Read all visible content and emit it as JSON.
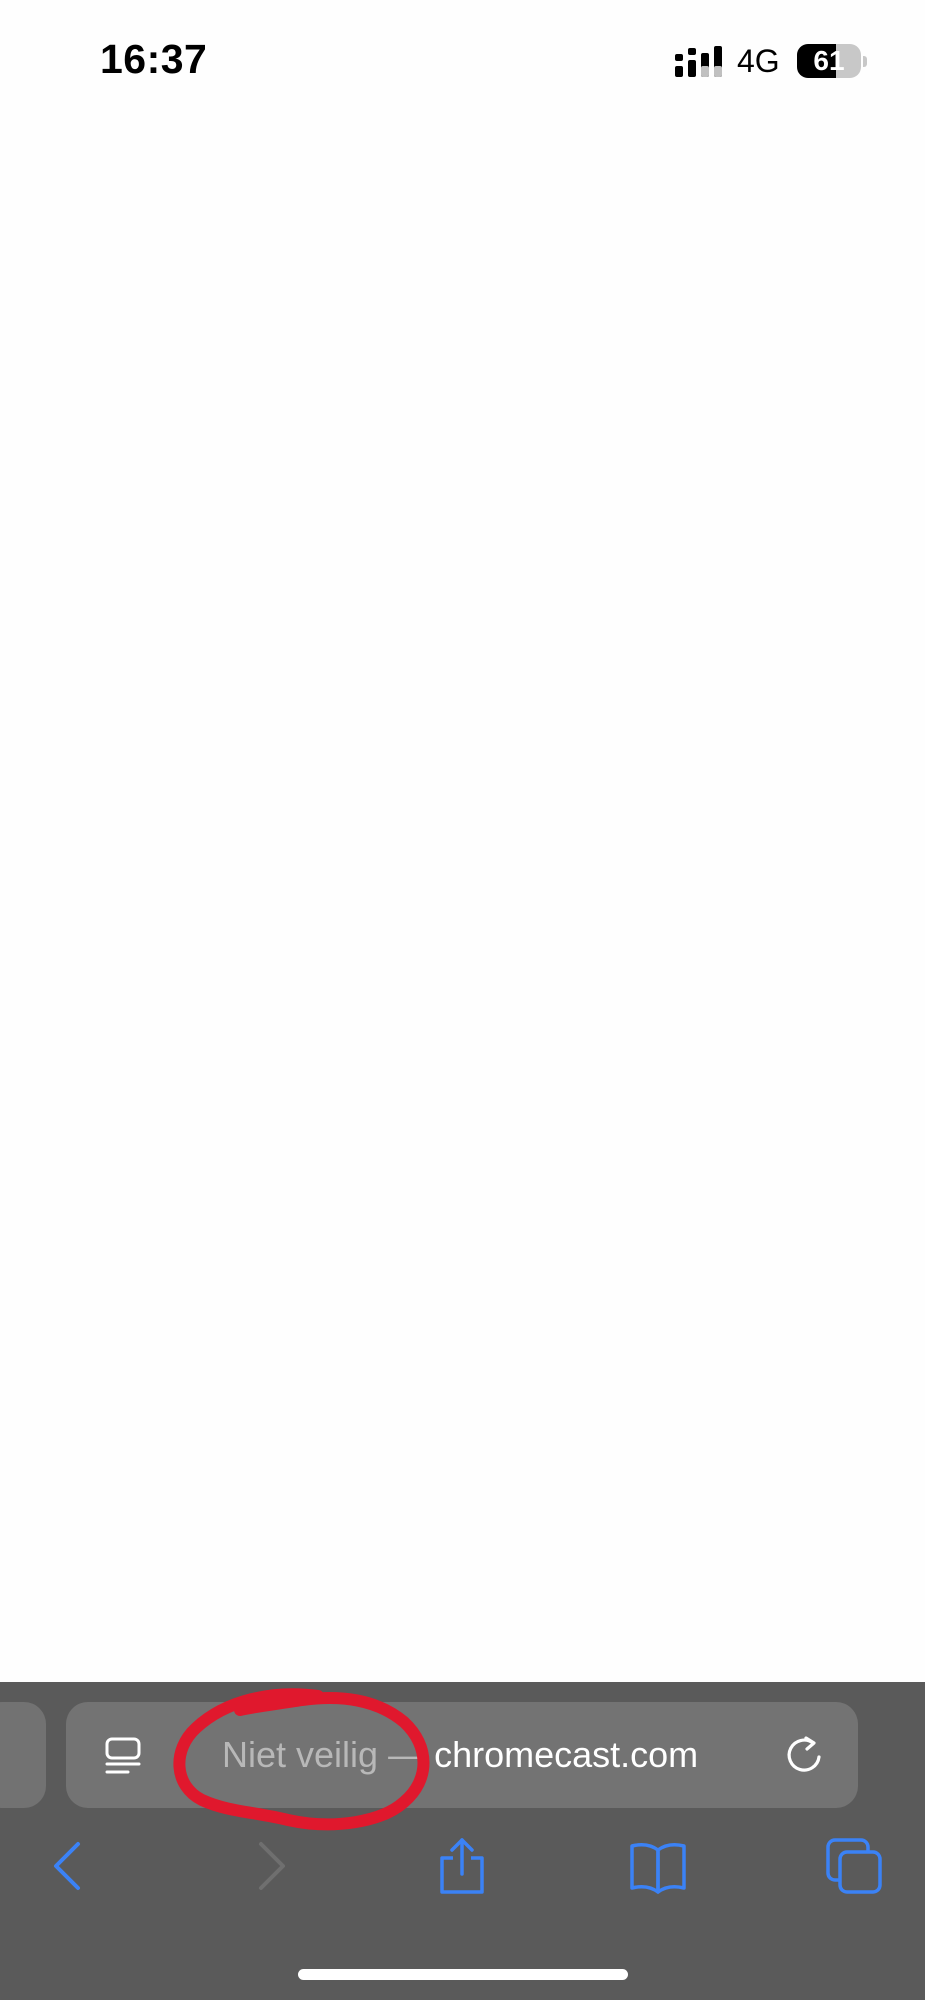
{
  "status_bar": {
    "time": "16:37",
    "network": "4G",
    "battery_level": "61",
    "battery_fraction": 0.61
  },
  "address_bar": {
    "security_label": "Niet veilig",
    "separator": "—",
    "domain": "chromecast.com",
    "reader_icon": "page-menu-icon",
    "reload_icon": "reload-icon"
  },
  "toolbar": {
    "back_icon": "chevron-left-icon",
    "forward_icon": "chevron-right-icon",
    "share_icon": "share-icon",
    "bookmarks_icon": "book-icon",
    "tabs_icon": "tabs-icon"
  },
  "colors": {
    "toolbar_background": "#5a5a5a",
    "address_bar_background": "#737373",
    "accent_blue": "#3b82f6",
    "annotation_red": "#e0182d"
  }
}
